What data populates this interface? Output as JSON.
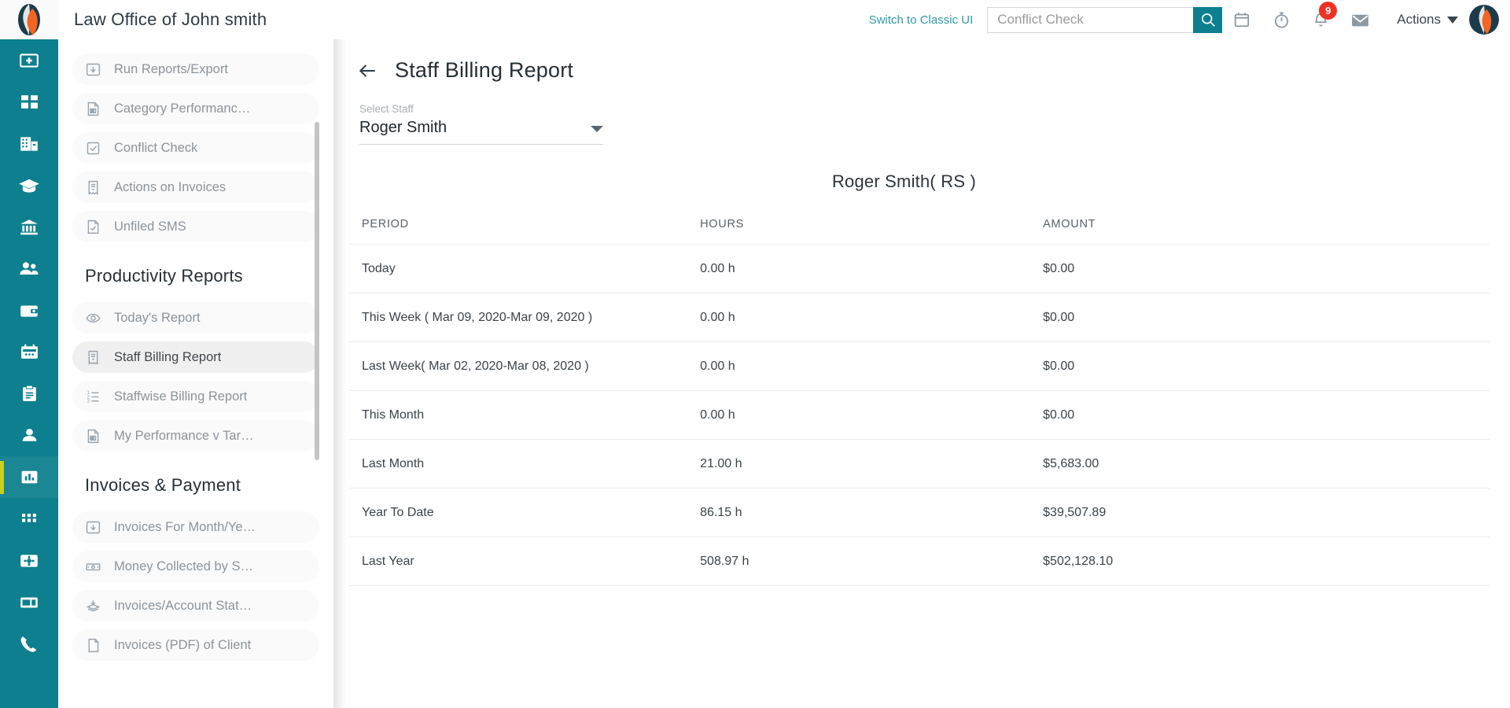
{
  "topbar": {
    "app_title": "Law Office of John smith",
    "classic_ui_link": "Switch to Classic UI",
    "search_placeholder": "Conflict Check",
    "search_value": "",
    "notification_count": "9",
    "actions_label": "Actions",
    "icons": [
      "search-icon",
      "calendar-icon",
      "timer-icon",
      "bell-icon",
      "envelope-icon",
      "chevron-down-icon",
      "avatar"
    ]
  },
  "rail": {
    "items": [
      {
        "name": "add-matter-icon",
        "active": false
      },
      {
        "name": "dashboard-icon",
        "active": false
      },
      {
        "name": "office-building-icon",
        "active": false
      },
      {
        "name": "graduation-cap-icon",
        "active": false
      },
      {
        "name": "courthouse-icon",
        "active": false
      },
      {
        "name": "contacts-icon",
        "active": false
      },
      {
        "name": "wallet-icon",
        "active": false
      },
      {
        "name": "calendar-icon",
        "active": false
      },
      {
        "name": "clipboard-icon",
        "active": false
      },
      {
        "name": "user-icon",
        "active": false
      },
      {
        "name": "reports-chart-icon",
        "active": true
      },
      {
        "name": "apps-grid-icon",
        "active": false
      },
      {
        "name": "settings-gear-icon",
        "active": false
      },
      {
        "name": "billing-card-icon",
        "active": false
      },
      {
        "name": "phone-icon",
        "active": false
      }
    ]
  },
  "subnav": {
    "top_items": [
      {
        "label": "Run Reports/Export",
        "icon": "download-box-icon",
        "selected": false
      },
      {
        "label": "Category Performanc…",
        "icon": "document-chart-icon",
        "selected": false
      },
      {
        "label": "Conflict Check",
        "icon": "checkbox-icon",
        "selected": false
      },
      {
        "label": "Actions on Invoices",
        "icon": "receipt-icon",
        "selected": false
      },
      {
        "label": "Unfiled SMS",
        "icon": "document-check-icon",
        "selected": false
      }
    ],
    "productivity_title": "Productivity Reports",
    "productivity_items": [
      {
        "label": "Today's Report",
        "icon": "eye-icon",
        "selected": false
      },
      {
        "label": "Staff Billing Report",
        "icon": "receipt-icon",
        "selected": true
      },
      {
        "label": "Staffwise Billing Report",
        "icon": "ordered-list-icon",
        "selected": false
      },
      {
        "label": "My Performance v Tar…",
        "icon": "document-chart-icon",
        "selected": false
      }
    ],
    "invoices_title": "Invoices & Payment",
    "invoices_items": [
      {
        "label": "Invoices For Month/Ye…",
        "icon": "download-box-icon",
        "selected": false
      },
      {
        "label": "Money Collected by S…",
        "icon": "cash-icon",
        "selected": false
      },
      {
        "label": "Invoices/Account Stat…",
        "icon": "stack-icon",
        "selected": false
      },
      {
        "label": "Invoices (PDF) of Client",
        "icon": "pdf-icon",
        "selected": false
      }
    ]
  },
  "main": {
    "page_title": "Staff Billing Report",
    "back_icon": "back-arrow-icon",
    "select_staff_label": "Select Staff",
    "select_staff_value": "Roger Smith",
    "report_subtitle": "Roger Smith( RS )",
    "table": {
      "headers": [
        "PERIOD",
        "HOURS",
        "AMOUNT"
      ],
      "rows": [
        {
          "period": "Today",
          "hours": "0.00 h",
          "amount": "$0.00"
        },
        {
          "period": "This Week ( Mar 09, 2020-Mar 09, 2020 )",
          "hours": "0.00 h",
          "amount": "$0.00"
        },
        {
          "period": "Last Week( Mar 02, 2020-Mar 08, 2020 )",
          "hours": "0.00 h",
          "amount": "$0.00"
        },
        {
          "period": "This Month",
          "hours": "0.00 h",
          "amount": "$0.00"
        },
        {
          "period": "Last Month",
          "hours": "21.00 h",
          "amount": "$5,683.00"
        },
        {
          "period": "Year To Date",
          "hours": "86.15 h",
          "amount": "$39,507.89"
        },
        {
          "period": "Last Year",
          "hours": "508.97 h",
          "amount": "$502,128.10"
        }
      ]
    }
  },
  "colors": {
    "brand_teal": "#0d7f8e",
    "accent_yellow": "#c9d11a",
    "badge_red": "#ef3124",
    "logo_orange": "#f26522",
    "logo_navy": "#1c3b4a"
  }
}
